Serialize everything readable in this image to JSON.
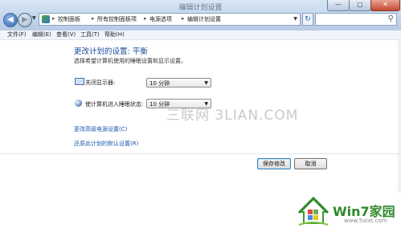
{
  "window": {
    "title": "编辑计划设置"
  },
  "controls": {
    "minimize": "—",
    "maximize": "▢",
    "close": "✕"
  },
  "address": {
    "crumbs": [
      "控制面板",
      "所有控制面板项",
      "电源选项",
      "编辑计划设置"
    ],
    "separator": "▸"
  },
  "search": {
    "placeholder": ""
  },
  "menu": [
    "文件(F)",
    "编辑(E)",
    "查看(V)",
    "工具(T)",
    "帮助(H)"
  ],
  "main": {
    "title": "更改计划的设置: 平衡",
    "subtitle": "选择希望计算机使用的睡眠设置和显示设置。"
  },
  "settings": [
    {
      "label": "关闭显示器:",
      "value": "10 分钟",
      "icon": "monitor-icon"
    },
    {
      "label": "使计算机进入睡眠状态:",
      "value": "10 分钟",
      "icon": "sleep-icon"
    }
  ],
  "links": {
    "advanced": "更改高级电源设置(C)",
    "restore": "还原此计划的默认设置(R)"
  },
  "buttons": {
    "save": "保存修改",
    "cancel": "取消"
  },
  "watermark": "三联网 3LIAN.COM",
  "logo": {
    "text": "Win7家园",
    "sub": "www.5aixt.com"
  }
}
